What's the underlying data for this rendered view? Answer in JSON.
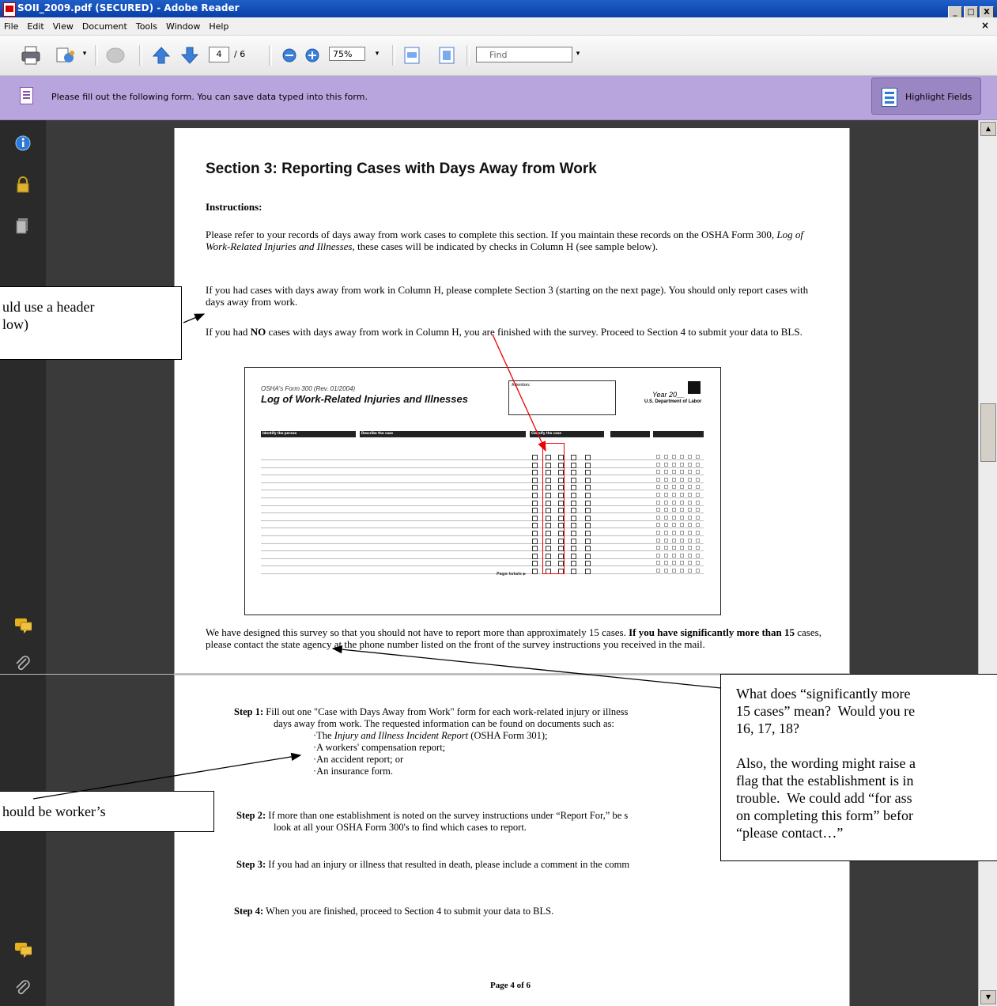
{
  "window": {
    "title": "SOII_2009.pdf (SECURED) - Adobe Reader",
    "controls": [
      "_",
      "□",
      "X"
    ]
  },
  "menu": {
    "items": [
      "File",
      "Edit",
      "View",
      "Document",
      "Tools",
      "Window",
      "Help"
    ],
    "close": "×"
  },
  "toolbar": {
    "page_current": "4",
    "page_total": "/ 6",
    "zoom": "75%",
    "find_placeholder": "Find"
  },
  "formbar": {
    "message": "Please fill out the following form. You can save data typed into this form.",
    "highlight_label": "Highlight Fields"
  },
  "document": {
    "section_title": "Section 3: Reporting Cases with Days Away from Work",
    "instructions_heading": "Instructions:",
    "para1_a": "Please refer to your records of days away from work cases to complete this section. If you maintain these records on the OSHA Form 300, ",
    "para1_italic": "Log of Work-Related Injuries and Illnesses",
    "para1_b": ", these cases will be indicated by checks in Column H (see sample below).",
    "para2": "If you had cases with days away from work in Column H, please complete Section 3 (starting on the next page).   You should only report cases with days away from work.",
    "para3_a": "If you had ",
    "para3_bold": "NO",
    "para3_b": " cases with days away from work in Column H, you are finished with the survey.  Proceed to Section 4 to submit your data to BLS.",
    "para4_a": "We have designed this survey so that you should not have to report more than approximately 15 cases. ",
    "para4_bold": "If you have significantly more than 15 ",
    "para4_b": "cases, please contact the state agency at the phone number listed on the front of the survey instructions you received in the mail.",
    "step1_label": "Step 1:",
    "step1_text": " Fill out one \"Case with Days Away from Work\" form for each work-related injury or illness",
    "step1_cont": "days away from work. The requested information can be found on documents such as:",
    "step1_list": [
      "·The ",
      "·A workers' compensation report;",
      "·An accident report; or",
      "·An insurance form."
    ],
    "step1_list0_italic": "Injury and Illness Incident Report",
    "step1_list0_tail": " (OSHA Form 301);",
    "step2_label": "Step 2:",
    "step2_text": " If more than one establishment is noted on the survey instructions under “Report For,” be s",
    "step2_cont": "look at all your OSHA Form 300's to find which cases to report.",
    "step3_label": "Step 3:",
    "step3_text": "  If you had an injury or illness that resulted in death, please include a comment in the comm",
    "step4_label": "Step 4:",
    "step4_text": "  When you are finished, proceed to Section 4 to submit your data to BLS.",
    "page_footer": "Page 4 of 6"
  },
  "osha_form": {
    "form_name": "OSHA's Form 300",
    "form_rev": " (Rev. 01/2004)",
    "title": "Log of Work-Related Injuries and Illnesses",
    "attention": "Attention:",
    "year": "Year 20__",
    "dept": "U.S. Department of Labor",
    "identify": "Identify the person",
    "describe": "Describe the case",
    "classify": "Classify the case",
    "page_totals": "Page totals ▶"
  },
  "comments": {
    "header": "uld use a header\nlow)",
    "significantly": "What does “significantly more\n15 cases” mean?  Would you re\n16, 17, 18?\n\nAlso, the wording might raise a\nflag that the establishment is in\ntrouble.  We could add “for ass\non completing this form” befor\n“please contact…”",
    "worker": "hould be worker’s"
  },
  "colors": {
    "title_bar": "#0a3ea7",
    "form_bar": "#b9a5de",
    "highlight_box": "#e00000"
  }
}
